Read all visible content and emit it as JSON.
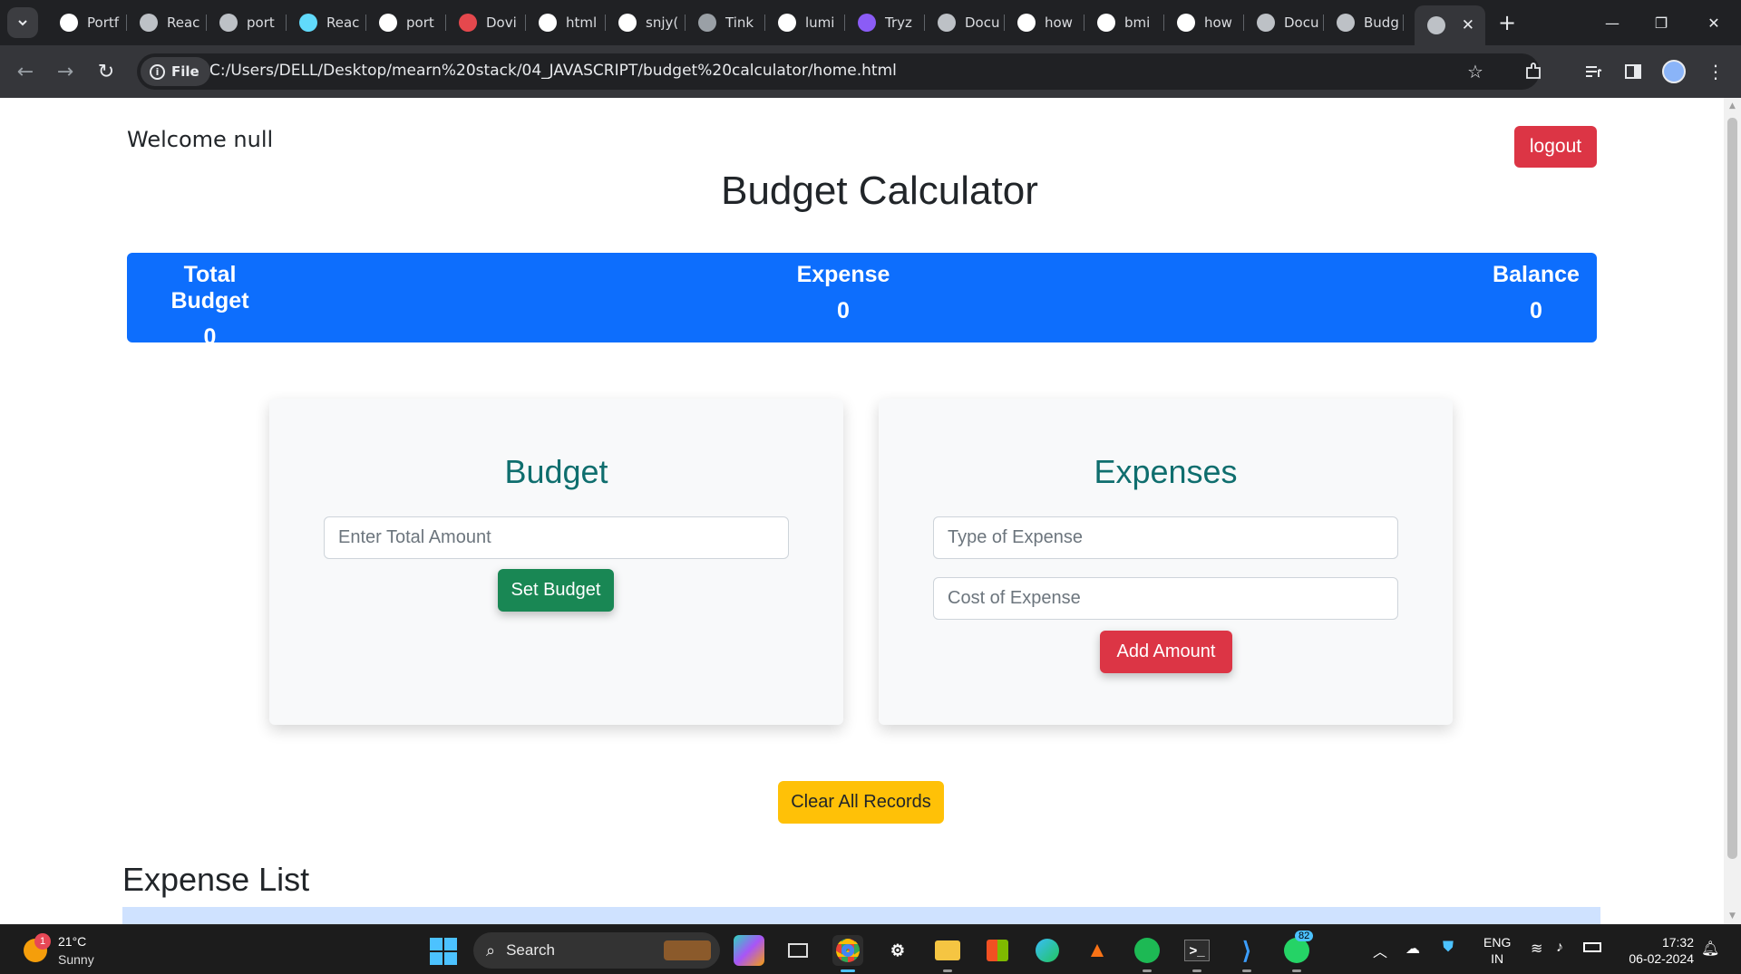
{
  "browser": {
    "tabs": [
      {
        "label": "Portf",
        "icon": "github-icon",
        "color": "#ffffff"
      },
      {
        "label": "Reac",
        "icon": "globe-icon",
        "color": "#bdc1c6"
      },
      {
        "label": "port",
        "icon": "globe-icon",
        "color": "#bdc1c6"
      },
      {
        "label": "Reac",
        "icon": "react-icon",
        "color": "#61dafb"
      },
      {
        "label": "port",
        "icon": "google-icon",
        "color": "#ffffff"
      },
      {
        "label": "Dovi",
        "icon": "app-red-icon",
        "color": "#e5484d"
      },
      {
        "label": "html",
        "icon": "google-icon",
        "color": "#ffffff"
      },
      {
        "label": "snjy(",
        "icon": "github-icon",
        "color": "#ffffff"
      },
      {
        "label": "Tink",
        "icon": "mortarboard-icon",
        "color": "#9aa0a6"
      },
      {
        "label": "lumi",
        "icon": "github-icon",
        "color": "#ffffff"
      },
      {
        "label": "Tryz",
        "icon": "list-purple-icon",
        "color": "#8b5cf6"
      },
      {
        "label": "Docu",
        "icon": "globe-icon",
        "color": "#bdc1c6"
      },
      {
        "label": "how",
        "icon": "google-icon",
        "color": "#ffffff"
      },
      {
        "label": "bmi",
        "icon": "google-icon",
        "color": "#ffffff"
      },
      {
        "label": "how",
        "icon": "google-icon",
        "color": "#ffffff"
      },
      {
        "label": "Docu",
        "icon": "globe-icon",
        "color": "#bdc1c6"
      },
      {
        "label": "Budg",
        "icon": "globe-icon",
        "color": "#bdc1c6"
      }
    ],
    "active_tab_icon": "globe-icon",
    "file_chip": "File",
    "url": "C:/Users/DELL/Desktop/mearn%20stack/04_JAVASCRIPT/budget%20calculator/home.html"
  },
  "page": {
    "welcome": "Welcome null",
    "logout": "logout",
    "title": "Budget Calculator",
    "summary": {
      "total_budget_label": "Total Budget",
      "total_budget_value": "0",
      "expense_label": "Expense",
      "expense_value": "0",
      "balance_label": "Balance",
      "balance_value": "0"
    },
    "budget_card": {
      "title": "Budget",
      "input_placeholder": "Enter Total Amount",
      "button": "Set Budget"
    },
    "expense_card": {
      "title": "Expenses",
      "type_placeholder": "Type of Expense",
      "cost_placeholder": "Cost of Expense",
      "button": "Add Amount"
    },
    "clear_button": "Clear All Records",
    "list_title": "Expense List"
  },
  "colors": {
    "primary": "#0d6efd",
    "danger": "#dc3545",
    "success": "#198754",
    "warning": "#ffc107",
    "card_title": "#0f6e6e"
  },
  "taskbar": {
    "weather_temp": "21°C",
    "weather_condition": "Sunny",
    "weather_badge": "1",
    "search": "Search",
    "whatsapp_badge": "82",
    "language": "ENG",
    "region": "IN",
    "time": "17:32",
    "date": "06-02-2024"
  }
}
